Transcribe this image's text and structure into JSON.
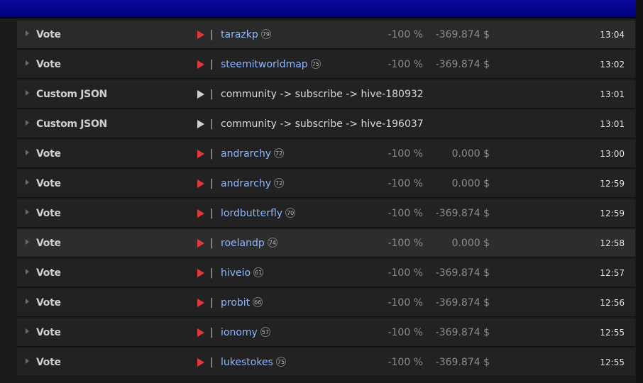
{
  "colors": {
    "header": "#0a0aa0",
    "row_bg": "#222222",
    "link": "#8fb7ff",
    "vote_arrow": "#e0393b",
    "custom_json_arrow": "#cfcfcf"
  },
  "icons": {
    "expander": "triangle-right-small",
    "vote": "play-icon-red",
    "custom_json": "play-icon-gray"
  },
  "rows": [
    {
      "type": "Vote",
      "target": "tarazkp",
      "rep": "79",
      "weight": "-100 %",
      "value": "-369.874 $",
      "time": "13:04",
      "kind": "vote"
    },
    {
      "type": "Vote",
      "target": "steemitworldmap",
      "rep": "75",
      "weight": "-100 %",
      "value": "-369.874 $",
      "time": "13:02",
      "kind": "vote"
    },
    {
      "type": "Custom JSON",
      "target": "community -> subscribe -> hive-180932",
      "rep": "",
      "weight": "",
      "value": "",
      "time": "13:01",
      "kind": "json"
    },
    {
      "type": "Custom JSON",
      "target": "community -> subscribe -> hive-196037",
      "rep": "",
      "weight": "",
      "value": "",
      "time": "13:01",
      "kind": "json"
    },
    {
      "type": "Vote",
      "target": "andrarchy",
      "rep": "72",
      "weight": "-100 %",
      "value": "0.000 $",
      "time": "13:00",
      "kind": "vote"
    },
    {
      "type": "Vote",
      "target": "andrarchy",
      "rep": "72",
      "weight": "-100 %",
      "value": "0.000 $",
      "time": "12:59",
      "kind": "vote"
    },
    {
      "type": "Vote",
      "target": "lordbutterfly",
      "rep": "70",
      "weight": "-100 %",
      "value": "-369.874 $",
      "time": "12:59",
      "kind": "vote"
    },
    {
      "type": "Vote",
      "target": "roelandp",
      "rep": "74",
      "weight": "-100 %",
      "value": "0.000 $",
      "time": "12:58",
      "kind": "vote"
    },
    {
      "type": "Vote",
      "target": "hiveio",
      "rep": "61",
      "weight": "-100 %",
      "value": "-369.874 $",
      "time": "12:57",
      "kind": "vote"
    },
    {
      "type": "Vote",
      "target": "probit",
      "rep": "66",
      "weight": "-100 %",
      "value": "-369.874 $",
      "time": "12:56",
      "kind": "vote"
    },
    {
      "type": "Vote",
      "target": "ionomy",
      "rep": "57",
      "weight": "-100 %",
      "value": "-369.874 $",
      "time": "12:55",
      "kind": "vote"
    },
    {
      "type": "Vote",
      "target": "lukestokes",
      "rep": "75",
      "weight": "-100 %",
      "value": "-369.874 $",
      "time": "12:55",
      "kind": "vote"
    }
  ]
}
